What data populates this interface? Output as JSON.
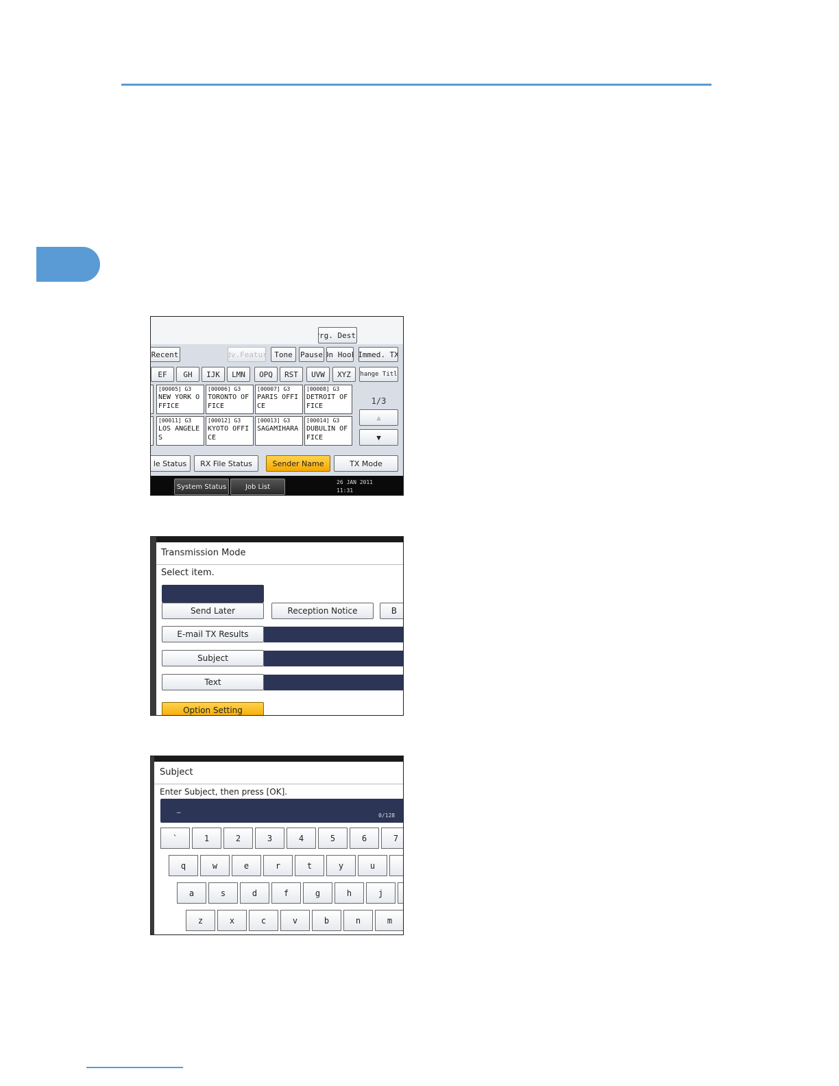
{
  "screen1": {
    "prg_dest": "Prg. Dest.",
    "recent": "Recent",
    "adv_feature": "Adv.Feature",
    "tone": "Tone",
    "pause": "Pause",
    "on_hook": "On Hook",
    "immed_tx": "Immed. TX",
    "tabs": [
      "EF",
      "GH",
      "IJK",
      "LMN",
      "OPQ",
      "RST",
      "UVW",
      "XYZ"
    ],
    "change_title": "Change Title",
    "destinations": [
      {
        "num": "[00005] G3",
        "name1": "NEW YORK O",
        "name2": "FFICE"
      },
      {
        "num": "[00006] G3",
        "name1": "TORONTO OF",
        "name2": "FICE"
      },
      {
        "num": "[00007] G3",
        "name1": "PARIS OFFI",
        "name2": "CE"
      },
      {
        "num": "[00008] G3",
        "name1": "DETROIT OF",
        "name2": "FICE"
      },
      {
        "num": "[00011] G3",
        "name1": "LOS ANGELE",
        "name2": "S"
      },
      {
        "num": "[00012] G3",
        "name1": "KYOTO OFFI",
        "name2": "CE"
      },
      {
        "num": "[00013] G3",
        "name1": "SAGAMIHARA",
        "name2": ""
      },
      {
        "num": "[00014] G3",
        "name1": "DUBULIN OF",
        "name2": "FICE"
      }
    ],
    "page": "1/3",
    "file_status": "le Status",
    "rx_file_status": "RX File Status",
    "sender_name": "Sender Name",
    "tx_mode": "TX Mode",
    "system_status": "System Status",
    "job_list": "Job List",
    "date": "26 JAN  2011",
    "time": "11:31"
  },
  "screen2": {
    "title": "Transmission Mode",
    "prompt": "Select item.",
    "send_later": "Send Later",
    "reception_notice": "Reception Notice",
    "partial": "B",
    "email_tx_results": "E-mail TX Results",
    "subject": "Subject",
    "text": "Text",
    "option_setting": "Option Setting"
  },
  "screen3": {
    "title": "Subject",
    "prompt": "Enter Subject, then press [OK].",
    "cursor": "_",
    "counter": "0/128",
    "row1": [
      "`",
      "1",
      "2",
      "3",
      "4",
      "5",
      "6",
      "7"
    ],
    "row2": [
      "q",
      "w",
      "e",
      "r",
      "t",
      "y",
      "u",
      ""
    ],
    "row3": [
      "a",
      "s",
      "d",
      "f",
      "g",
      "h",
      "j",
      ""
    ],
    "row4": [
      "z",
      "x",
      "c",
      "v",
      "b",
      "n",
      "m"
    ]
  }
}
